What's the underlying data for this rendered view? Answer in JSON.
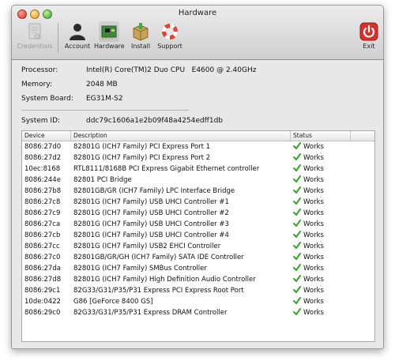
{
  "window": {
    "title": "Hardware"
  },
  "toolbar": {
    "credentials": "Credentials",
    "account": "Account",
    "hardware": "Hardware",
    "install": "Install",
    "support": "Support",
    "exit": "Exit"
  },
  "info": {
    "processor_label": "Processor:",
    "processor_value": "Intel(R) Core(TM)2 Duo CPU   E4600 @ 2.40GHz",
    "memory_label": "Memory:",
    "memory_value": "2048 MB",
    "board_label": "System Board:",
    "board_value": "EG31M-S2",
    "sysid_label": "System ID:",
    "sysid_value": "ddc79c1606a1e2b09f48a4254edff1db"
  },
  "table": {
    "headers": {
      "device": "Device",
      "description": "Description",
      "status": "Status"
    },
    "status_color": "#3aa32e",
    "rows": [
      {
        "device": "8086:27d0",
        "description": "82801G (ICH7 Family) PCI Express Port 1",
        "status": "Works"
      },
      {
        "device": "8086:27d2",
        "description": "82801G (ICH7 Family) PCI Express Port 2",
        "status": "Works"
      },
      {
        "device": "10ec:8168",
        "description": "RTL8111/8168B PCI Express Gigabit Ethernet controller",
        "status": "Works"
      },
      {
        "device": "8086:244e",
        "description": "82801 PCI Bridge",
        "status": "Works"
      },
      {
        "device": "8086:27b8",
        "description": "82801GB/GR (ICH7 Family) LPC Interface Bridge",
        "status": "Works"
      },
      {
        "device": "8086:27c8",
        "description": "82801G (ICH7 Family) USB UHCI Controller #1",
        "status": "Works"
      },
      {
        "device": "8086:27c9",
        "description": "82801G (ICH7 Family) USB UHCI Controller #2",
        "status": "Works"
      },
      {
        "device": "8086:27ca",
        "description": "82801G (ICH7 Family) USB UHCI Controller #3",
        "status": "Works"
      },
      {
        "device": "8086:27cb",
        "description": "82801G (ICH7 Family) USB UHCI Controller #4",
        "status": "Works"
      },
      {
        "device": "8086:27cc",
        "description": "82801G (ICH7 Family) USB2 EHCI Controller",
        "status": "Works"
      },
      {
        "device": "8086:27c0",
        "description": "82801GB/GR/GH (ICH7 Family) SATA IDE Controller",
        "status": "Works"
      },
      {
        "device": "8086:27da",
        "description": "82801G (ICH7 Family) SMBus Controller",
        "status": "Works"
      },
      {
        "device": "8086:27d8",
        "description": "82801G (ICH7 Family) High Definition Audio Controller",
        "status": "Works"
      },
      {
        "device": "8086:29c1",
        "description": "82G33/G31/P35/P31 Express PCI Express Root Port",
        "status": "Works"
      },
      {
        "device": "10de:0422",
        "description": "G86 [GeForce 8400 GS]",
        "status": "Works"
      },
      {
        "device": "8086:29c0",
        "description": "82G33/G31/P35/P31 Express DRAM Controller",
        "status": "Works"
      }
    ]
  }
}
